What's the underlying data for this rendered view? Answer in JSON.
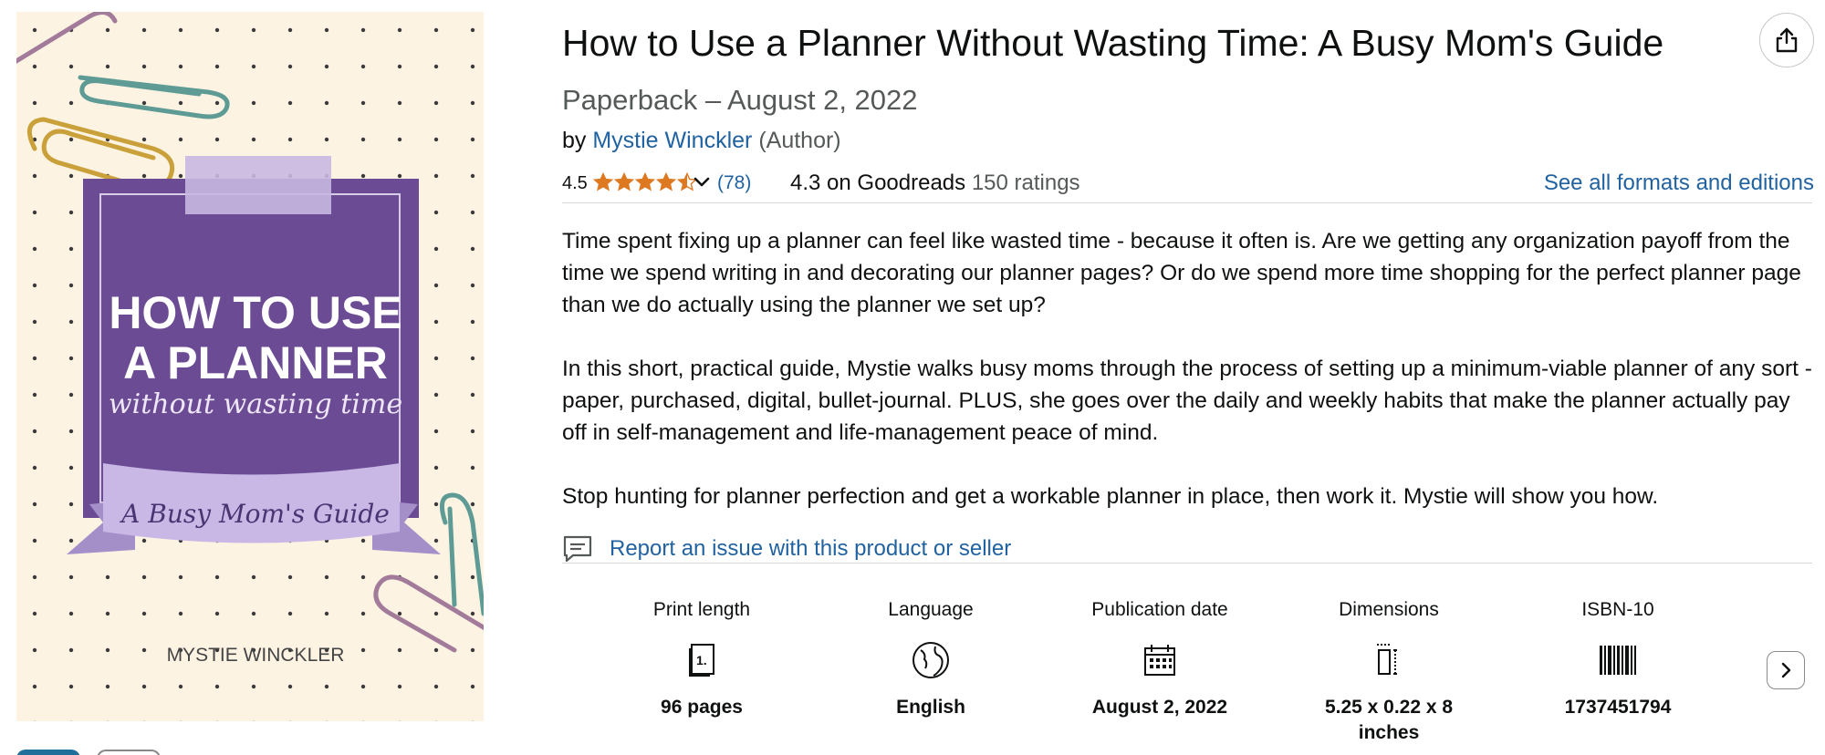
{
  "cover": {
    "title_line1": "HOW TO USE",
    "title_line2": "A PLANNER",
    "script_line": "without wasting time",
    "ribbon_text": "A Busy Mom's Guide",
    "author": "MYSTIE WINCKLER"
  },
  "product": {
    "title": "How to Use a Planner Without Wasting Time: A Busy Mom's Guide",
    "format_date": "Paperback – August 2, 2022",
    "by_prefix": "by",
    "author_name": "Mystie Winckler",
    "author_role": "(Author)"
  },
  "ratings": {
    "average": "4.5",
    "stars_value": 4.5,
    "count": "(78)",
    "goodreads": "4.3 on Goodreads",
    "goodreads_count": "150 ratings",
    "all_formats_link": "See all formats and editions"
  },
  "description": [
    "Time spent fixing up a planner can feel like wasted time - because it often is. Are we getting any organization payoff from the time we spend writing in and decorating our planner pages? Or do we spend more time shopping for the perfect planner page than we do actually using the planner we set up?",
    "In this short, practical guide, Mystie walks busy moms through the process of setting up a minimum-viable planner of any sort - paper, purchased, digital, bullet-journal. PLUS, she goes over the daily and weekly habits that make the planner actually pay off in self-management and life-management peace of mind.",
    "Stop hunting for planner perfection and get a workable planner in place, then work it. Mystie will show you how."
  ],
  "report_link": "Report an issue with this product or seller",
  "details": [
    {
      "label": "Print length",
      "icon": "book-page-icon",
      "value": "96 pages"
    },
    {
      "label": "Language",
      "icon": "globe-icon",
      "value": "English"
    },
    {
      "label": "Publication date",
      "icon": "calendar-icon",
      "value": "August 2, 2022"
    },
    {
      "label": "Dimensions",
      "icon": "dimensions-icon",
      "value": "5.25 x 0.22 x 8 inches"
    },
    {
      "label": "ISBN-10",
      "icon": "barcode-icon",
      "value": "1737451794"
    }
  ],
  "colors": {
    "link": "#2162a1",
    "star": "#de7921",
    "cover_purple": "#6b4c94",
    "ribbon": "#b9a6d8",
    "cover_bg": "#fdf3e3"
  }
}
